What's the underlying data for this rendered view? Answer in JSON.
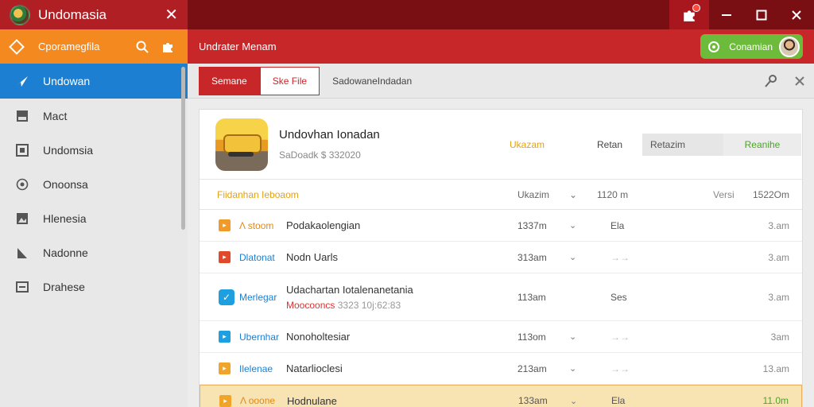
{
  "app": {
    "title": "Undomasia"
  },
  "sidebar": {
    "search_label": "Cporamegfila",
    "items": [
      {
        "label": "Undowan",
        "icon": "send-icon",
        "active": true
      },
      {
        "label": "Mact",
        "icon": "drive-icon",
        "active": false
      },
      {
        "label": "Undomsia",
        "icon": "grid-icon",
        "active": false
      },
      {
        "label": "Onoonsa",
        "icon": "target-icon",
        "active": false
      },
      {
        "label": "Hlenesia",
        "icon": "image-icon",
        "active": false
      },
      {
        "label": "Nadonne",
        "icon": "chart-icon",
        "active": false
      },
      {
        "label": "Drahese",
        "icon": "box-icon",
        "active": false
      }
    ]
  },
  "header": {
    "title": "Undrater Menam",
    "status_label": "Conamian"
  },
  "toolbar": {
    "tab_primary": "Semane",
    "tab_secondary": "Ske File",
    "path": "SadowaneIndadan"
  },
  "app_card": {
    "name": "Undovhan Ionadan",
    "subtitle": "SaDoadk $ 332020",
    "status": "Ukazam",
    "ret": "Retan",
    "btn_grey": "Retazim",
    "btn_green": "Reanihe"
  },
  "table": {
    "header": {
      "name": "Fiidanhan Ieboaom",
      "size": "Ukazim",
      "c2": "1120 m",
      "ver": "Versi",
      "right": "1522Om"
    },
    "rows": [
      {
        "icon_color": "#f09a2a",
        "tag": "Λ stoom",
        "tag_color": "#e08a1a",
        "name": "Podakaolengian",
        "size": "1337m",
        "c2": "Ela",
        "right": "3.am"
      },
      {
        "icon_color": "#e04a2a",
        "tag": "Dlatonat",
        "tag_color": "#1d7fd1",
        "name": "Nodn Uarls",
        "size": "313am",
        "c2": "→→",
        "right": "3.am"
      },
      {
        "icon_color": "#1d9fe0",
        "tag": "Merlegar",
        "tag_color": "#1d7fd1",
        "name": "Udachartan Iotalenanetania",
        "sub": "Moocooncs",
        "sub2": "3323 10j:62:83",
        "size": "113am",
        "c2": "Ses",
        "right": "3.am"
      },
      {
        "icon_color": "#1d9fe0",
        "tag": "Ubernhar",
        "tag_color": "#1d7fd1",
        "name": "Nonoholtesiar",
        "size": "113om",
        "c2": "→→",
        "right": "3am"
      },
      {
        "icon_color": "#f0a52a",
        "tag": "Ilelenae",
        "tag_color": "#1d7fd1",
        "name": "Natarlioclesi",
        "size": "213am",
        "c2": "→→",
        "right": "13.am"
      },
      {
        "icon_color": "#f0a52a",
        "tag": "Λ ooone",
        "tag_color": "#e08a1a",
        "name": "Hodnulane",
        "size": "133am",
        "c2": "Ela",
        "right": "11.0m"
      }
    ]
  }
}
